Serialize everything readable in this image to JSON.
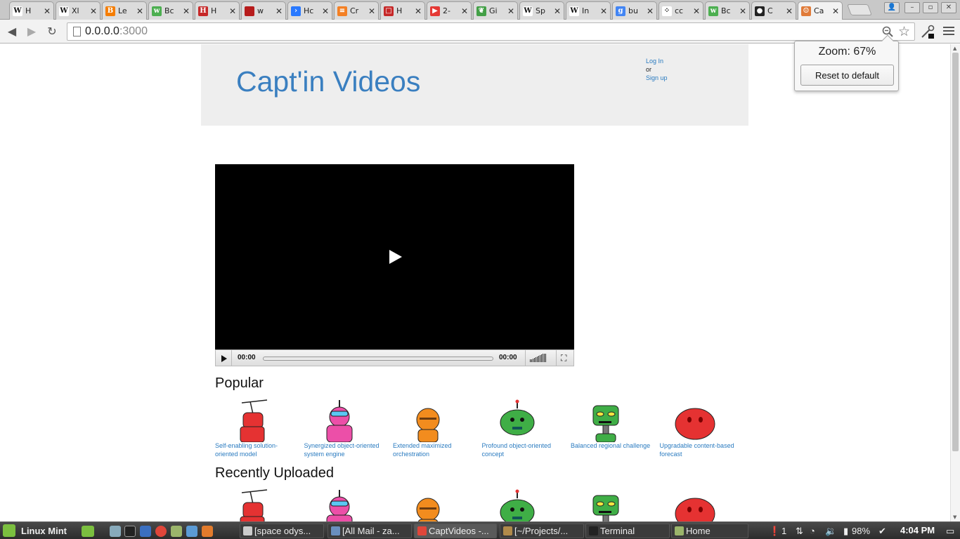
{
  "browser": {
    "tabs": [
      {
        "label": "H",
        "icon": "wikipedia-icon",
        "glyph": "W",
        "color": "#ffffff"
      },
      {
        "label": "Xl",
        "icon": "wikipedia-icon",
        "glyph": "W",
        "color": "#ffffff"
      },
      {
        "label": "Le",
        "icon": "blogger-icon",
        "glyph": "B",
        "color": "#f57d00"
      },
      {
        "label": "Bc",
        "icon": "wowhead-icon",
        "glyph": "w",
        "color": "#4caf50"
      },
      {
        "label": "H",
        "icon": "hi-icon",
        "glyph": "H",
        "color": "#c62828"
      },
      {
        "label": "w",
        "icon": "shield-icon",
        "glyph": "",
        "color": "#b71c1c"
      },
      {
        "label": "Hc",
        "icon": "arrow-icon",
        "glyph": "›",
        "color": "#2979ff"
      },
      {
        "label": "Cr",
        "icon": "stackoverflow-icon",
        "glyph": "≡",
        "color": "#f48024"
      },
      {
        "label": "H",
        "icon": "book-icon",
        "glyph": "□",
        "color": "#c62828"
      },
      {
        "label": "2-",
        "icon": "youtube-icon",
        "glyph": "▶",
        "color": "#e53935"
      },
      {
        "label": "Gi",
        "icon": "spring-icon",
        "glyph": "❦",
        "color": "#43a047"
      },
      {
        "label": "Sp",
        "icon": "wikipedia-icon",
        "glyph": "W",
        "color": "#ffffff"
      },
      {
        "label": "In",
        "icon": "wikipedia-icon",
        "glyph": "W",
        "color": "#ffffff"
      },
      {
        "label": "bu",
        "icon": "google-icon",
        "glyph": "g",
        "color": "#4285f4"
      },
      {
        "label": "cc",
        "icon": "dots-icon",
        "glyph": "⁘",
        "color": "#ffffff"
      },
      {
        "label": "Bc",
        "icon": "wowhead-icon",
        "glyph": "w",
        "color": "#4caf50"
      },
      {
        "label": "C",
        "icon": "github-icon",
        "glyph": "●",
        "color": "#222222"
      },
      {
        "label": "Ca",
        "icon": "robot-icon",
        "glyph": "☺",
        "color": "#e07b39"
      }
    ],
    "url_host": "0.0.0.0",
    "url_port": ":3000",
    "zoom_label": "Zoom: 67%",
    "reset_label": "Reset to default"
  },
  "site": {
    "title": "Capt'in Videos",
    "login": "Log In",
    "or": "or",
    "signup": "Sign up"
  },
  "player": {
    "current_time": "00:00",
    "duration": "00:00",
    "progress_fraction": 0
  },
  "sections": {
    "popular_title": "Popular",
    "recent_title": "Recently Uploaded"
  },
  "videos": [
    {
      "title": "Self-enabling solution-oriented model",
      "robot": "antenna-red",
      "color": "#e53232"
    },
    {
      "title": "Synergized object-oriented system engine",
      "robot": "pink-visor",
      "color": "#ec4fa8"
    },
    {
      "title": "Extended maximized orchestration",
      "robot": "orange-round",
      "color": "#f28c1e"
    },
    {
      "title": "Profound object-oriented concept",
      "robot": "green-dome",
      "color": "#3fae46"
    },
    {
      "title": "Balanced regional challenge",
      "robot": "green-box",
      "color": "#3fae46"
    },
    {
      "title": "Upgradable content-based forecast",
      "robot": "red-dome",
      "color": "#e53232"
    }
  ],
  "taskbar": {
    "menu_label": "Linux Mint",
    "tasks": [
      {
        "label": "[space odys...",
        "icon": "media-icon"
      },
      {
        "label": "[All Mail - za...",
        "icon": "mail-icon"
      },
      {
        "label": "CaptVideos -...",
        "icon": "chrome-icon"
      },
      {
        "label": "[~/Projects/...",
        "icon": "editor-icon"
      },
      {
        "label": "Terminal",
        "icon": "terminal-icon"
      },
      {
        "label": "Home",
        "icon": "folder-icon"
      }
    ],
    "notifications": "1",
    "battery": "98%",
    "clock": "4:04 PM"
  }
}
